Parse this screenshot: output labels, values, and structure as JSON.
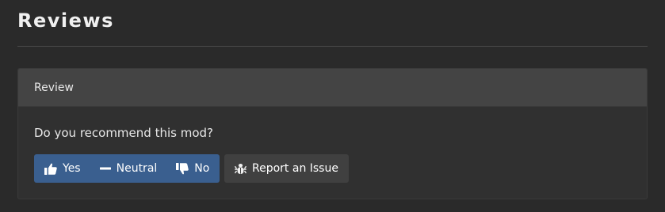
{
  "section": {
    "title": "Reviews"
  },
  "review_card": {
    "header": "Review",
    "question": "Do you recommend this mod?",
    "buttons": {
      "yes": {
        "label": "Yes",
        "icon": "thumbs-up-icon"
      },
      "neutral": {
        "label": "Neutral",
        "icon": "minus-icon"
      },
      "no": {
        "label": "No",
        "icon": "thumbs-down-icon"
      },
      "report": {
        "label": "Report an Issue",
        "icon": "bug-icon"
      }
    }
  },
  "colors": {
    "background": "#2a2a2a",
    "card": "#303030",
    "card_header": "#444444",
    "vote_group": "#3a5f8f",
    "report_button": "#404040"
  }
}
